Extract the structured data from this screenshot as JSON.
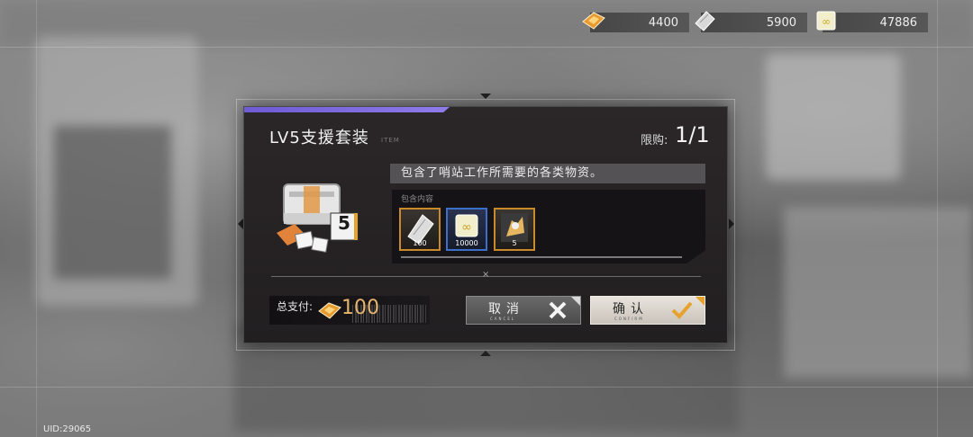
{
  "currencies": [
    {
      "icon": "gold-ticket-icon",
      "value": "4400"
    },
    {
      "icon": "silver-card-icon",
      "value": "5900"
    },
    {
      "icon": "infinity-coin-icon",
      "value": "47886"
    }
  ],
  "dialog": {
    "title": "LV5支援套装",
    "title_sub": "ITEM",
    "limit_label": "限购:",
    "limit_value": "1/1",
    "description": "包含了哨站工作所需要的各类物资。",
    "contents_label": "包含内容",
    "pack_badge": "5",
    "items": [
      {
        "icon": "silver-card-icon",
        "qty": "100",
        "rarity_color": "#c98a2a"
      },
      {
        "icon": "infinity-coin-icon",
        "qty": "10000",
        "rarity_color": "#3b6fc9"
      },
      {
        "icon": "gold-lion-icon",
        "qty": "5",
        "rarity_color": "#c98a2a"
      }
    ],
    "divider_mark": "×",
    "total_label": "总支付:",
    "total_value": "100",
    "cancel_label": "取消",
    "cancel_sub": "CANCEL",
    "confirm_label": "确认",
    "confirm_sub": "CONFIRM"
  },
  "uid": "UID:29065",
  "colors": {
    "accent_purple": "#7a66e0",
    "price_gold": "#e7b56c",
    "confirm_orange": "#e7a22e"
  }
}
